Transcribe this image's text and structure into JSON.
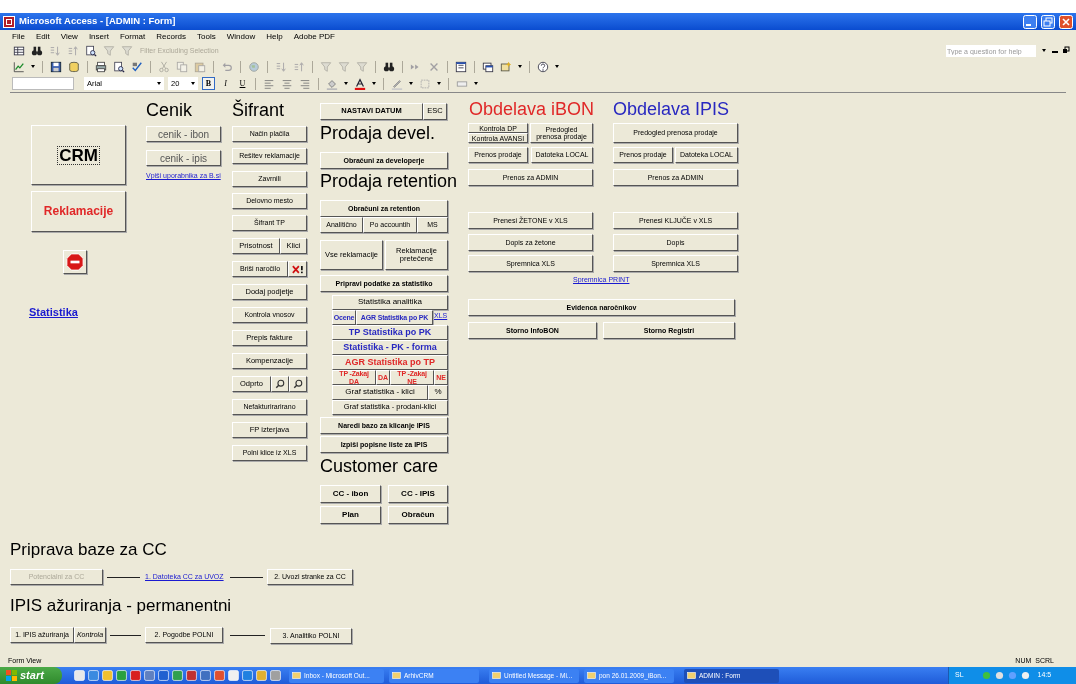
{
  "window": {
    "title": "Microsoft Access - [ADMIN : Form]"
  },
  "menu": [
    "File",
    "Edit",
    "View",
    "Insert",
    "Format",
    "Records",
    "Tools",
    "Window",
    "Help",
    "Adobe PDF"
  ],
  "toolbar": {
    "filter_label": "Filter Excluding Selection"
  },
  "format_toolbar": {
    "font": "Arial",
    "size": "20",
    "buttons": [
      {
        "label": "B",
        "on": true
      },
      {
        "label": "I",
        "on": false
      },
      {
        "label": "U",
        "on": false
      }
    ]
  },
  "help_box": {
    "placeholder": "Type a question for help"
  },
  "form": {
    "controls": [
      {
        "kind": "heading",
        "text": "Cenik"
      },
      {
        "kind": "heading",
        "text": "Šifrant"
      },
      {
        "kind": "button",
        "text": "NASTAVI DATUM",
        "disabled": false
      },
      {
        "kind": "button",
        "text": "ESC",
        "disabled": false
      },
      {
        "kind": "heading",
        "text": "Obdelava iBON",
        "color": "#e02828"
      },
      {
        "kind": "heading",
        "text": "Obdelava IPIS",
        "color": "#2828c0"
      },
      {
        "kind": "button",
        "text": "CRM",
        "disabled": false,
        "focused": true
      },
      {
        "kind": "button",
        "text": "Reklamacije",
        "disabled": false,
        "color": "#e02828"
      },
      {
        "kind": "stop-button"
      },
      {
        "kind": "link",
        "text": "Statistika"
      },
      {
        "kind": "button",
        "text": "cenik - ibon",
        "disabled": false
      },
      {
        "kind": "button",
        "text": "cenik - ipis",
        "disabled": false
      },
      {
        "kind": "link",
        "text": "Vpiši uporabnika za B.si"
      },
      {
        "kind": "button",
        "text": "Način plačila",
        "disabled": false
      },
      {
        "kind": "button",
        "text": "Rešitev reklamacije",
        "disabled": false
      },
      {
        "kind": "button",
        "text": "Zavrnili",
        "disabled": false
      },
      {
        "kind": "button",
        "text": "Delovno mesto",
        "disabled": false
      },
      {
        "kind": "button",
        "text": "Šifrant TP",
        "disabled": false
      },
      {
        "kind": "button",
        "text": "Prisotnost",
        "disabled": false
      },
      {
        "kind": "button",
        "text": "Klici",
        "disabled": false
      },
      {
        "kind": "button",
        "text": "Briši naročilo",
        "disabled": false
      },
      {
        "kind": "delete-button"
      },
      {
        "kind": "button",
        "text": "Dodaj podjetje",
        "disabled": false
      },
      {
        "kind": "button",
        "text": "Kontrola vnosov",
        "disabled": false
      },
      {
        "kind": "button",
        "text": "Prepis fakture",
        "disabled": false
      },
      {
        "kind": "button",
        "text": "Kompenzacije",
        "disabled": false
      },
      {
        "kind": "button",
        "text": "Odprto",
        "disabled": false
      },
      {
        "kind": "search-button"
      },
      {
        "kind": "search-button"
      },
      {
        "kind": "button",
        "text": "Nefakturirarirano",
        "disabled": false
      },
      {
        "kind": "button",
        "text": "FP izterjava",
        "disabled": false
      },
      {
        "kind": "button",
        "text": "Polni klice iz XLS",
        "disabled": false
      },
      {
        "kind": "heading",
        "text": "Prodaja devel."
      },
      {
        "kind": "button",
        "text": "Obračuni za developerje",
        "disabled": false
      },
      {
        "kind": "heading",
        "text": "Prodaja retention"
      },
      {
        "kind": "button",
        "text": "Obračuni za retention",
        "disabled": false
      },
      {
        "kind": "button",
        "text": "Analitično",
        "disabled": false
      },
      {
        "kind": "button",
        "text": "Po accountih",
        "disabled": false
      },
      {
        "kind": "button",
        "text": "MS",
        "disabled": false
      },
      {
        "kind": "button",
        "text": "Vse reklamacije",
        "disabled": false
      },
      {
        "kind": "button",
        "text": "Reklamacije pretečene",
        "disabled": false
      },
      {
        "kind": "button",
        "text": "Pripravi podatke za statistiko",
        "disabled": false
      },
      {
        "kind": "button",
        "text": "Statistika analitika",
        "disabled": false
      },
      {
        "kind": "button",
        "text": "Ocene",
        "disabled": false,
        "color": "#2828c0"
      },
      {
        "kind": "button",
        "text": "AGR Statistika po PK",
        "disabled": false,
        "color": "#2828c0"
      },
      {
        "kind": "link",
        "text": "XLS"
      },
      {
        "kind": "button",
        "text": "TP Statistika po PK",
        "disabled": false,
        "color": "#2828c0"
      },
      {
        "kind": "button",
        "text": "Statistika - PK - forma",
        "disabled": false,
        "color": "#2828c0"
      },
      {
        "kind": "button",
        "text": "AGR Statistika po TP",
        "disabled": false,
        "color": "#e02828"
      },
      {
        "kind": "button",
        "text": "TP -Zakaj DA",
        "disabled": false,
        "color": "#e02828"
      },
      {
        "kind": "button",
        "text": "DA",
        "disabled": false,
        "color": "#e02828"
      },
      {
        "kind": "button",
        "text": "TP -Zakaj NE",
        "disabled": false,
        "color": "#e02828"
      },
      {
        "kind": "button",
        "text": "NE",
        "disabled": false,
        "color": "#e02828"
      },
      {
        "kind": "button",
        "text": "Graf statistika - klici",
        "disabled": false
      },
      {
        "kind": "button",
        "text": "%",
        "disabled": false
      },
      {
        "kind": "button",
        "text": "Graf statistika - prodani-klici",
        "disabled": false
      },
      {
        "kind": "button",
        "text": "Naredi bazo za klicanje IPIS",
        "disabled": false
      },
      {
        "kind": "button",
        "text": "Izpiši popisne liste za IPIS",
        "disabled": false
      },
      {
        "kind": "heading",
        "text": "Customer care"
      },
      {
        "kind": "button",
        "text": "CC - ibon",
        "disabled": false
      },
      {
        "kind": "button",
        "text": "CC - IPIS",
        "disabled": false
      },
      {
        "kind": "button",
        "text": "Plan",
        "disabled": false
      },
      {
        "kind": "button",
        "text": "Obračun",
        "disabled": false
      },
      {
        "kind": "button",
        "text": "Kontrola DP",
        "disabled": false
      },
      {
        "kind": "button",
        "text": "Kontrola AVANSI",
        "disabled": false
      },
      {
        "kind": "button",
        "text": "Predogled prenosa prodaje",
        "disabled": false
      },
      {
        "kind": "button",
        "text": "Prenos prodaje",
        "disabled": false
      },
      {
        "kind": "button",
        "text": "Datoteka LOCAL",
        "disabled": false
      },
      {
        "kind": "button",
        "text": "Prenos za ADMIN",
        "disabled": false
      },
      {
        "kind": "button",
        "text": "Prenesi ŽETONE v XLS",
        "disabled": false
      },
      {
        "kind": "button",
        "text": "Dopis za žetone",
        "disabled": false
      },
      {
        "kind": "button",
        "text": "Spremnica XLS",
        "disabled": false
      },
      {
        "kind": "button",
        "text": "Predogled prenosa prodaje",
        "disabled": false
      },
      {
        "kind": "button",
        "text": "Prenos prodaje",
        "disabled": false
      },
      {
        "kind": "button",
        "text": "Datoteka LOCAL",
        "disabled": false
      },
      {
        "kind": "button",
        "text": "Prenos za ADMIN",
        "disabled": false
      },
      {
        "kind": "button",
        "text": "Prenesi KLJUČE v XLS",
        "disabled": false
      },
      {
        "kind": "button",
        "text": "Dopis",
        "disabled": false
      },
      {
        "kind": "button",
        "text": "Spremnica XLS",
        "disabled": false
      },
      {
        "kind": "link",
        "text": "Spremnica PRINT"
      },
      {
        "kind": "button",
        "text": "Evidenca naročnikov",
        "disabled": false
      },
      {
        "kind": "button",
        "text": "Storno InfoBON",
        "disabled": false
      },
      {
        "kind": "button",
        "text": "Storno Registri",
        "disabled": false
      },
      {
        "kind": "heading",
        "text": "Priprava baze za CC"
      },
      {
        "kind": "button",
        "text": "Potencialni za CC",
        "disabled": true
      },
      {
        "kind": "connector"
      },
      {
        "kind": "link",
        "text": "1. Datoteka CC za UVOZ"
      },
      {
        "kind": "connector"
      },
      {
        "kind": "button",
        "text": "2. Uvozi stranke za CC",
        "disabled": false
      },
      {
        "kind": "heading",
        "text": "IPIS ažuriranja - permanentni"
      },
      {
        "kind": "button",
        "text": "1. IPIS ažuriranja",
        "disabled": false
      },
      {
        "kind": "button",
        "text": "Kontrola",
        "disabled": false
      },
      {
        "kind": "connector"
      },
      {
        "kind": "button",
        "text": "2. Pogodbe POLNI",
        "disabled": false
      },
      {
        "kind": "connector"
      },
      {
        "kind": "button",
        "text": "3. Analitiko POLNI",
        "disabled": false
      }
    ]
  },
  "status_bar": {
    "mode": "Form View",
    "indicators": [
      "NUM",
      "SCRL"
    ]
  },
  "taskbar": {
    "start": "start",
    "tasks": [
      {
        "label": "Inbox - Microsoft Out...",
        "selected": false
      },
      {
        "label": "ArhivCRM",
        "selected": false
      },
      {
        "label": "Untitled Message - Mi...",
        "selected": false
      },
      {
        "label": "pon 26.01.2009_iBon...",
        "selected": false
      },
      {
        "label": "ADMIN : Form",
        "selected": true
      }
    ],
    "language": "SL",
    "clock": "14:5"
  }
}
